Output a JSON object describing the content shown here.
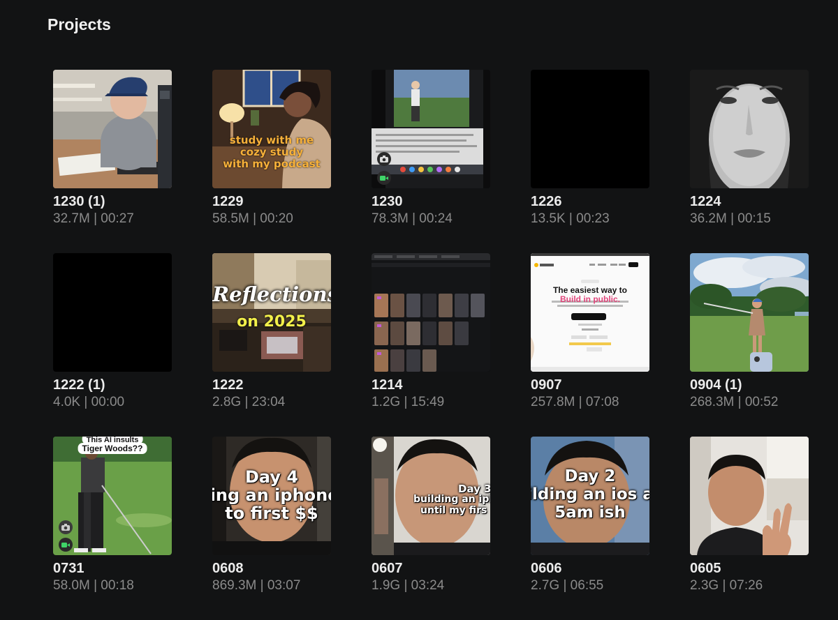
{
  "header": {
    "title": "Projects"
  },
  "projects": [
    {
      "name": "1230 (1)",
      "meta": "32.7M | 00:27"
    },
    {
      "name": "1229",
      "meta": "58.5M | 00:20",
      "overlay": [
        "study with me",
        "cozy study",
        "with my podcast"
      ]
    },
    {
      "name": "1230",
      "meta": "78.3M | 00:24"
    },
    {
      "name": "1226",
      "meta": "13.5K | 00:23"
    },
    {
      "name": "1224",
      "meta": "36.2M | 00:15"
    },
    {
      "name": "1222 (1)",
      "meta": "4.0K | 00:00"
    },
    {
      "name": "1222",
      "meta": "2.8G | 23:04",
      "overlay": [
        "Reflections",
        "on 2025"
      ]
    },
    {
      "name": "1214",
      "meta": "1.2G | 15:49"
    },
    {
      "name": "0907",
      "meta": "257.8M | 07:08",
      "overlay": [
        "The easiest way to",
        "Build in public."
      ]
    },
    {
      "name": "0904 (1)",
      "meta": "268.3M | 00:52"
    },
    {
      "name": "0731",
      "meta": "58.0M | 00:18",
      "overlay": [
        "This AI insults",
        "Tiger Woods??"
      ]
    },
    {
      "name": "0608",
      "meta": "869.3M | 03:07",
      "overlay": [
        "Day 4",
        "ling an iphone",
        "to first $$"
      ]
    },
    {
      "name": "0607",
      "meta": "1.9G | 03:24",
      "overlay": [
        "Day 3",
        "building an iph",
        "until my firs"
      ]
    },
    {
      "name": "0606",
      "meta": "2.7G | 06:55",
      "overlay": [
        "Day 2",
        "ilding an ios a",
        "5am ish"
      ]
    },
    {
      "name": "0605",
      "meta": "2.3G | 07:26"
    }
  ]
}
